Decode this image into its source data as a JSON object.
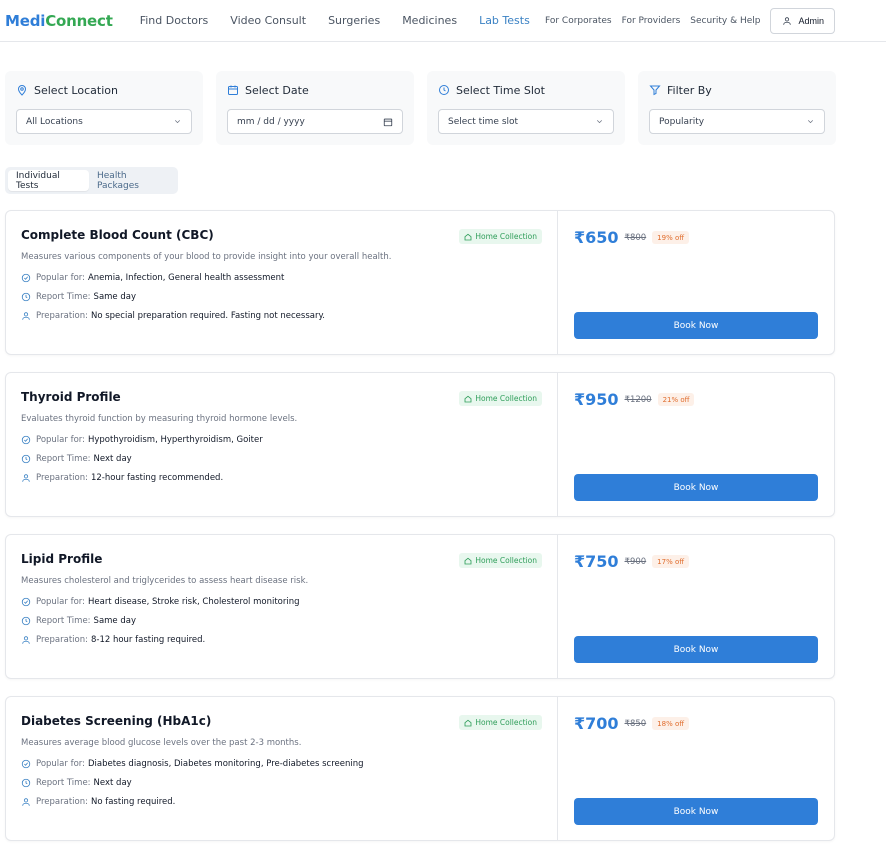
{
  "brand": {
    "part1": "Medi",
    "part2": "Connect"
  },
  "nav": {
    "items": [
      "Find Doctors",
      "Video Consult",
      "Surgeries",
      "Medicines",
      "Lab Tests"
    ],
    "active_index": 4
  },
  "right_nav": {
    "links": [
      "For Corporates",
      "For Providers",
      "Security & Help"
    ],
    "admin_label": "Admin"
  },
  "filters": [
    {
      "label": "Select Location",
      "icon": "map-pin-icon",
      "value": "All Locations"
    },
    {
      "label": "Select Date",
      "icon": "calendar-icon",
      "value": "mm / dd / yyyy"
    },
    {
      "label": "Select Time Slot",
      "icon": "clock-icon",
      "value": "Select time slot"
    },
    {
      "label": "Filter By",
      "icon": "filter-icon",
      "value": "Popularity"
    }
  ],
  "tabs": [
    "Individual Tests",
    "Health Packages"
  ],
  "labels": {
    "badge": "Home Collection",
    "popular_for": "Popular for:",
    "report_time": "Report Time:",
    "preparation": "Preparation:",
    "book": "Book Now"
  },
  "colors": {
    "accent": "#2f7ed8",
    "brand_green": "#34a853",
    "badge_green": "#2f9e5a",
    "discount_orange": "#e06c2c"
  },
  "tests": [
    {
      "name": "Complete Blood Count (CBC)",
      "description": "Measures various components of your blood to provide insight into your overall health.",
      "popular_for": "Anemia, Infection, General health assessment",
      "report_time": "Same day",
      "preparation": "No special preparation required. Fasting not necessary.",
      "price": "₹650",
      "original": "₹800",
      "discount": "19% off"
    },
    {
      "name": "Thyroid Profile",
      "description": "Evaluates thyroid function by measuring thyroid hormone levels.",
      "popular_for": "Hypothyroidism, Hyperthyroidism, Goiter",
      "report_time": "Next day",
      "preparation": "12-hour fasting recommended.",
      "price": "₹950",
      "original": "₹1200",
      "discount": "21% off"
    },
    {
      "name": "Lipid Profile",
      "description": "Measures cholesterol and triglycerides to assess heart disease risk.",
      "popular_for": "Heart disease, Stroke risk, Cholesterol monitoring",
      "report_time": "Same day",
      "preparation": "8-12 hour fasting required.",
      "price": "₹750",
      "original": "₹900",
      "discount": "17% off"
    },
    {
      "name": "Diabetes Screening (HbA1c)",
      "description": "Measures average blood glucose levels over the past 2-3 months.",
      "popular_for": "Diabetes diagnosis, Diabetes monitoring, Pre-diabetes screening",
      "report_time": "Next day",
      "preparation": "No fasting required.",
      "price": "₹700",
      "original": "₹850",
      "discount": "18% off"
    }
  ]
}
